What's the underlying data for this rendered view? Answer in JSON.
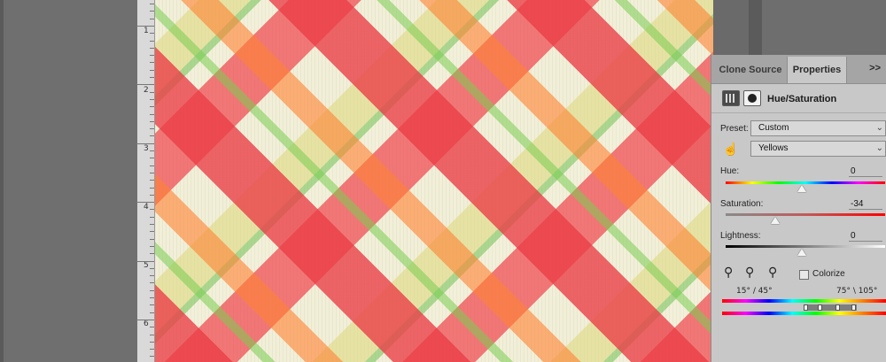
{
  "ruler": {
    "numbers": [
      "1",
      "2",
      "3",
      "4",
      "5",
      "6"
    ]
  },
  "panel": {
    "tabs": [
      {
        "label": "Clone Source",
        "active": false
      },
      {
        "label": "Properties",
        "active": true
      }
    ],
    "menu_label": ">>",
    "adjustment_title": "Hue/Saturation",
    "preset_label": "Preset:",
    "preset_value": "Custom",
    "channel_value": "Yellows",
    "hue": {
      "label": "Hue:",
      "value": "0"
    },
    "saturation": {
      "label": "Saturation:",
      "value": "-34"
    },
    "lightness": {
      "label": "Lightness:",
      "value": "0"
    },
    "colorize_label": "Colorize",
    "colorize_checked": false,
    "range_left": "15° / 45°",
    "range_right": "75° \\ 105°",
    "icons": {
      "adjustment": "adjustment-layer-icon",
      "mask": "layer-mask-icon",
      "targeted_adjust": "hand-adjust-icon",
      "eyedropper": "eyedropper-icon",
      "eyedropper_add": "eyedropper-plus-icon",
      "eyedropper_subtract": "eyedropper-minus-icon"
    }
  }
}
